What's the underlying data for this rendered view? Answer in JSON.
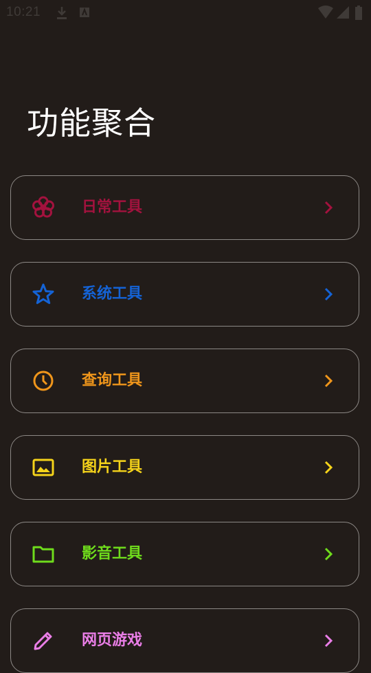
{
  "status_bar": {
    "time": "10:21"
  },
  "page": {
    "title": "功能聚合"
  },
  "menu": {
    "items": [
      {
        "label": "日常工具",
        "icon": "flower-icon",
        "color": "#a3123e"
      },
      {
        "label": "系统工具",
        "icon": "star-icon",
        "color": "#1463d6"
      },
      {
        "label": "查询工具",
        "icon": "clock-icon",
        "color": "#f0961b"
      },
      {
        "label": "图片工具",
        "icon": "image-icon",
        "color": "#f5d31a"
      },
      {
        "label": "影音工具",
        "icon": "folder-icon",
        "color": "#6fdc1c"
      },
      {
        "label": "网页游戏",
        "icon": "pencil-icon",
        "color": "#ea7ee7"
      }
    ]
  }
}
